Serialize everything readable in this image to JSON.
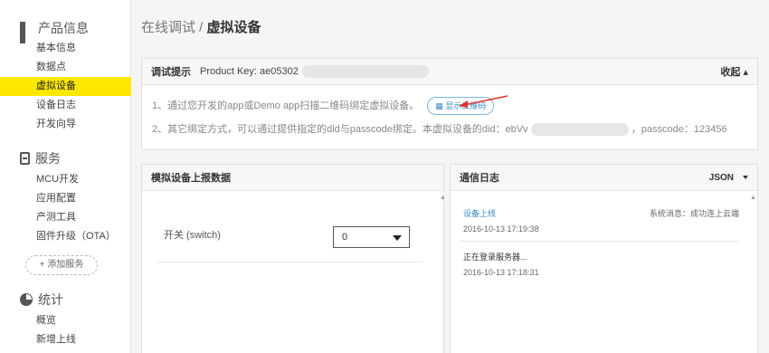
{
  "sidebar": {
    "product_info": {
      "title": "产品信息",
      "items": [
        "基本信息",
        "数据点",
        "虚拟设备",
        "设备日志",
        "开发向导"
      ]
    },
    "services": {
      "title": "服务",
      "items": [
        "MCU开发",
        "应用配置",
        "产测工具",
        "固件升级（OTA）"
      ],
      "add_label": "+ 添加服务"
    },
    "stats": {
      "title": "统计",
      "items": [
        "概览",
        "新增上线"
      ]
    }
  },
  "breadcrumb": {
    "parent": "在线调试",
    "separator": " / ",
    "current": "虚拟设备"
  },
  "tip_panel": {
    "title": "调试提示",
    "product_key_label": "Product Key: ae05302",
    "collapse_label": "收起 ▴",
    "line1": "1、通过您开发的app或Demo app扫描二维码绑定虚拟设备。",
    "qr_button": "▦ 显示二维码",
    "line2_prefix": "2、其它绑定方式，可以通过提供指定的did与passcode绑定。本虚拟设备的did：ebVv",
    "line2_suffix": "，passcode：123456"
  },
  "upload_panel": {
    "title": "模拟设备上报数据",
    "fields": [
      {
        "label": "开关 (switch)",
        "value": "0"
      }
    ]
  },
  "log_panel": {
    "title": "通信日志",
    "format": "JSON",
    "entries": [
      {
        "title": "设备上线",
        "message": "系统消息：成功连上云端",
        "time": "2016-10-13 17:19:38"
      },
      {
        "title": "正在登录服务器...",
        "message": "",
        "time": "2016-10-13 17:18:31"
      }
    ]
  },
  "colors": {
    "accent_yellow": "#ffe800",
    "link_blue": "#3a8cc4"
  }
}
